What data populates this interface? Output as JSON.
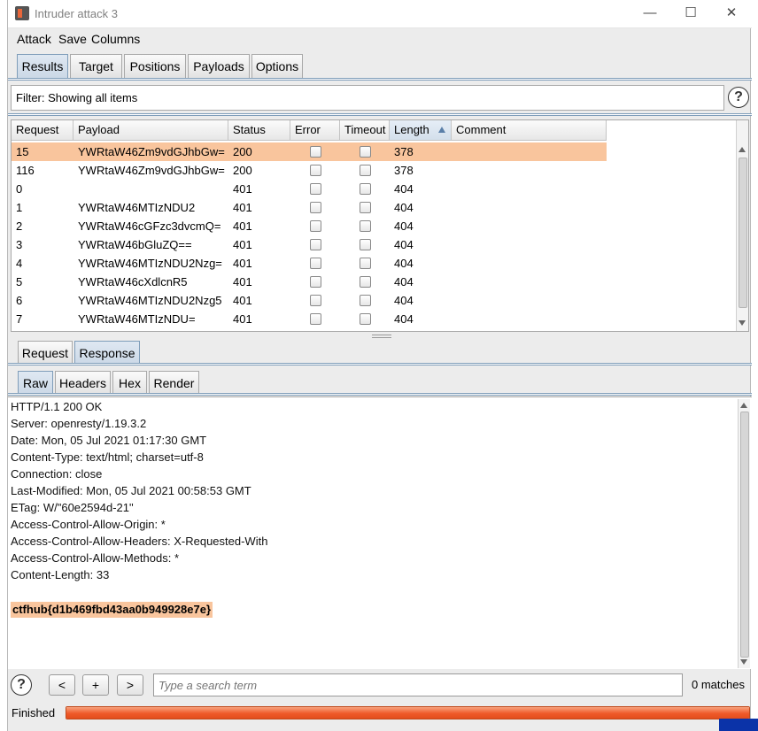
{
  "window": {
    "title": "Intruder attack 3",
    "min_glyph": "—",
    "max_glyph": "☐",
    "close_glyph": "✕"
  },
  "menu": [
    "Attack",
    "Save",
    "Columns"
  ],
  "top_tabs": [
    {
      "label": "Results",
      "selected": true
    },
    {
      "label": "Target",
      "selected": false
    },
    {
      "label": "Positions",
      "selected": false
    },
    {
      "label": "Payloads",
      "selected": false
    },
    {
      "label": "Options",
      "selected": false
    }
  ],
  "filter": {
    "text": "Filter: Showing all items",
    "help": "?"
  },
  "results_table": {
    "columns": [
      "Request",
      "Payload",
      "Status",
      "Error",
      "Timeout",
      "Length",
      "Comment"
    ],
    "sorted_column": "Length",
    "rows": [
      {
        "request": "15",
        "payload": "YWRtaW46Zm9vdGJhbGw=",
        "status": "200",
        "length": "378",
        "highlight": true
      },
      {
        "request": "116",
        "payload": "YWRtaW46Zm9vdGJhbGw=",
        "status": "200",
        "length": "378",
        "highlight": false
      },
      {
        "request": "0",
        "payload": "",
        "status": "401",
        "length": "404",
        "highlight": false
      },
      {
        "request": "1",
        "payload": "YWRtaW46MTIzNDU2",
        "status": "401",
        "length": "404",
        "highlight": false
      },
      {
        "request": "2",
        "payload": "YWRtaW46cGFzc3dvcmQ=",
        "status": "401",
        "length": "404",
        "highlight": false
      },
      {
        "request": "3",
        "payload": "YWRtaW46bGluZQ==",
        "status": "401",
        "length": "404",
        "highlight": false
      },
      {
        "request": "4",
        "payload": "YWRtaW46MTIzNDU2Nzg=",
        "status": "401",
        "length": "404",
        "highlight": false
      },
      {
        "request": "5",
        "payload": "YWRtaW46cXdlcnR5",
        "status": "401",
        "length": "404",
        "highlight": false
      },
      {
        "request": "6",
        "payload": "YWRtaW46MTIzNDU2Nzg5",
        "status": "401",
        "length": "404",
        "highlight": false
      },
      {
        "request": "7",
        "payload": "YWRtaW46MTIzNDU=",
        "status": "401",
        "length": "404",
        "highlight": false
      }
    ]
  },
  "detail_tabs": [
    {
      "label": "Request",
      "selected": false
    },
    {
      "label": "Response",
      "selected": true
    }
  ],
  "view_tabs": [
    {
      "label": "Raw",
      "selected": true
    },
    {
      "label": "Headers",
      "selected": false
    },
    {
      "label": "Hex",
      "selected": false
    },
    {
      "label": "Render",
      "selected": false
    }
  ],
  "response": {
    "lines": [
      "HTTP/1.1 200 OK",
      "Server: openresty/1.19.3.2",
      "Date: Mon, 05 Jul 2021 01:17:30 GMT",
      "Content-Type: text/html; charset=utf-8",
      "Connection: close",
      "Last-Modified: Mon, 05 Jul 2021 00:58:53 GMT",
      "ETag: W/\"60e2594d-21\"",
      "Access-Control-Allow-Origin: *",
      "Access-Control-Allow-Headers: X-Requested-With",
      "Access-Control-Allow-Methods: *",
      "Content-Length: 33"
    ],
    "flag": "ctfhub{d1b469fbd43aa0b949928e7e}"
  },
  "search": {
    "help": "?",
    "prev": "<",
    "add": "+",
    "next": ">",
    "placeholder": "Type a search term",
    "matches": "0 matches"
  },
  "status": {
    "text": "Finished",
    "progress": 1.0
  },
  "colors": {
    "highlight": "#f9c59d",
    "progress": "#ef5a2a",
    "selected_tab": "#cbd8e6"
  }
}
